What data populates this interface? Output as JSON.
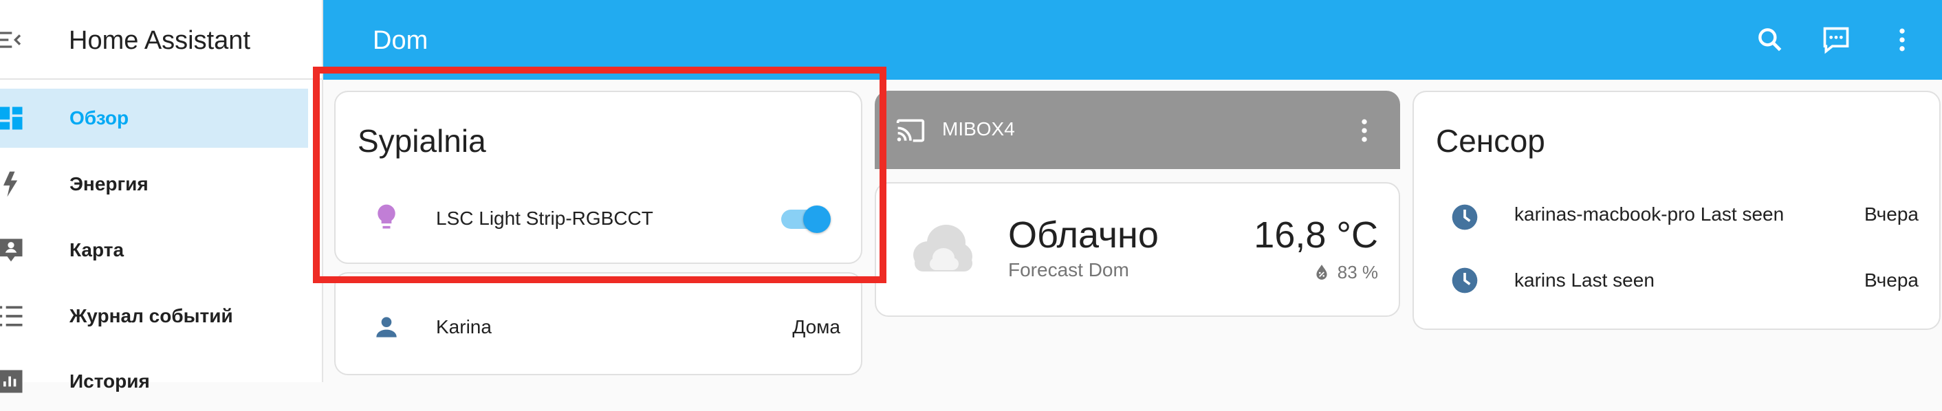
{
  "app": {
    "title": "Home Assistant"
  },
  "sidebar": {
    "items": [
      {
        "label": "Обзор",
        "icon": "dashboard-icon",
        "active": true
      },
      {
        "label": "Энергия",
        "icon": "lightning-bolt-icon"
      },
      {
        "label": "Карта",
        "icon": "map-account-icon"
      },
      {
        "label": "Журнал событий",
        "icon": "logbook-list-icon"
      },
      {
        "label": "История",
        "icon": "history-chart-icon"
      }
    ]
  },
  "header": {
    "title": "Dom",
    "icons": [
      "search-icon",
      "assist-chat-icon",
      "more-vertical-icon"
    ]
  },
  "cards": {
    "sypialnia": {
      "title": "Sypialnia",
      "light": {
        "name": "LSC Light Strip-RGBCCT",
        "icon": "lightbulb-icon",
        "icon_color": "#c17ed6",
        "on": true
      }
    },
    "person": {
      "name": "Karina",
      "state": "Дома",
      "icon": "account-icon"
    },
    "media": {
      "name": "MIBOX4",
      "icon": "cast-icon"
    },
    "weather": {
      "condition": "Облачно",
      "subtitle": "Forecast Dom",
      "temperature": "16,8 °C",
      "humidity": "83 %",
      "icon": "cloudy-icon"
    },
    "sensor": {
      "title": "Сенсор",
      "rows": [
        {
          "name": "karinas-macbook-pro Last seen",
          "state": "Вчера",
          "icon": "clock-icon"
        },
        {
          "name": "karins Last seen",
          "state": "Вчера",
          "icon": "clock-icon"
        }
      ]
    }
  },
  "colors": {
    "accent": "#03a9f4",
    "header_bg": "#22abf0",
    "entity_icon": "#44739e",
    "highlight_box": "#ee2b24"
  }
}
